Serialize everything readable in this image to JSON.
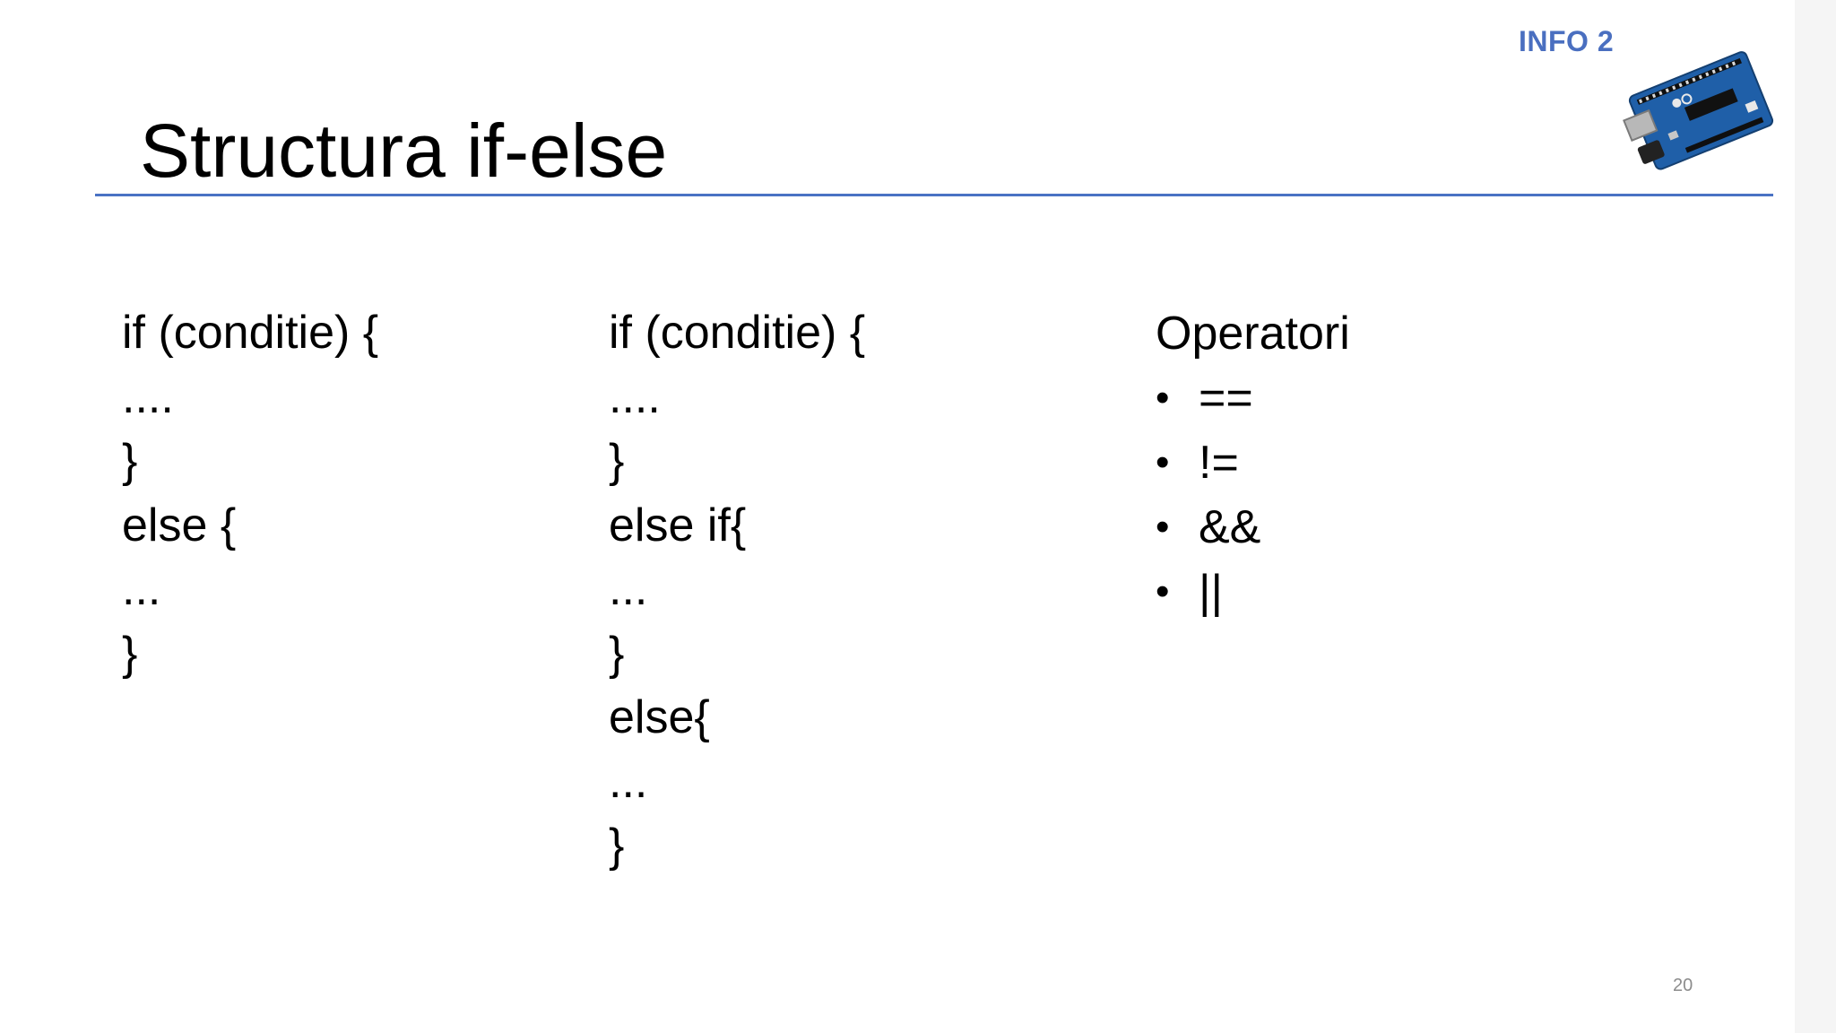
{
  "header": {
    "badge": "INFO 2",
    "title": "Structura if-else"
  },
  "columns": {
    "if_else": [
      "if (conditie) {",
      "....",
      "}",
      "else {",
      "...",
      "}"
    ],
    "if_else_if": [
      "if (conditie) {",
      "....",
      "}",
      "else if{",
      "...",
      "}",
      "else{",
      "...",
      "}"
    ]
  },
  "operators": {
    "heading": "Operatori",
    "bullet_glyph": "•",
    "items": [
      "==",
      "!=",
      "&&",
      "||"
    ]
  },
  "footer": {
    "page_number": "20"
  },
  "colors": {
    "accent": "#4a72c4",
    "badge": "#4a6fc0",
    "board": "#1f5fa8"
  },
  "icons": {
    "board": "arduino-board-image"
  }
}
